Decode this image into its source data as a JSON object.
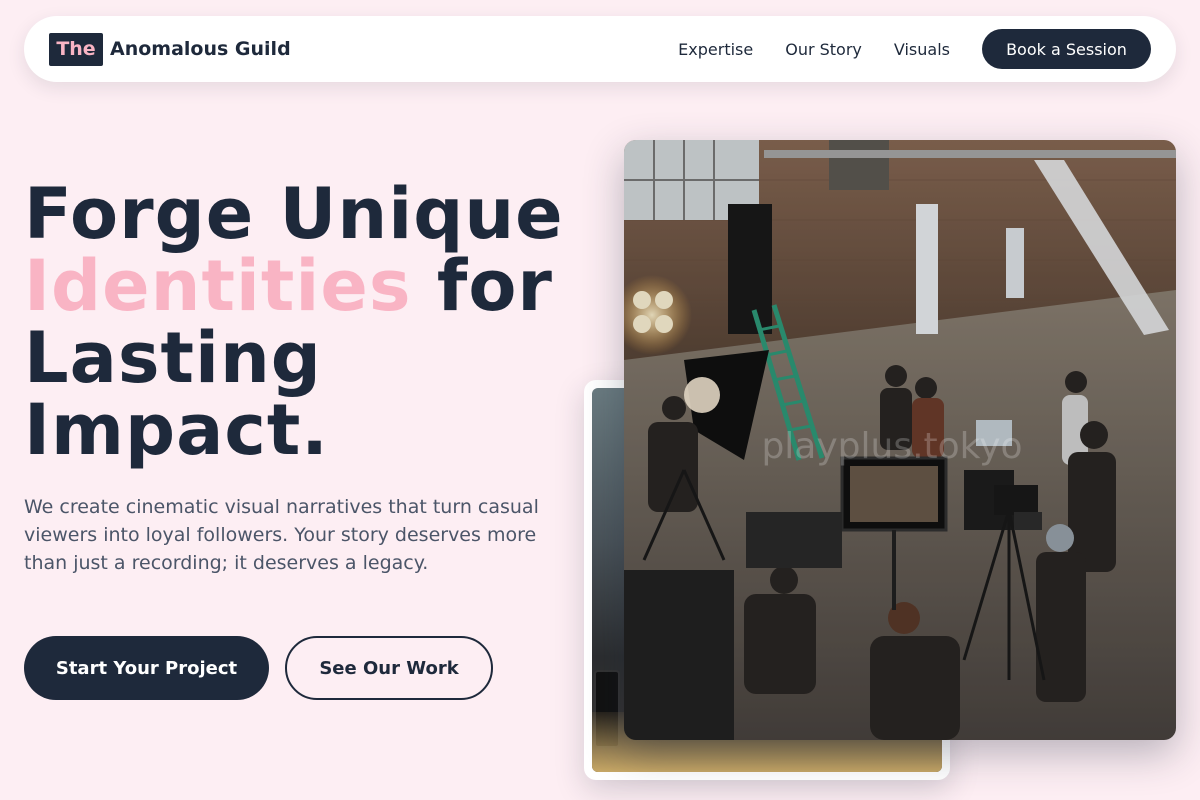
{
  "nav": {
    "logo_badge": "The",
    "logo_text": "Anomalous Guild",
    "links": [
      "Expertise",
      "Our Story",
      "Visuals"
    ],
    "cta": "Book a Session"
  },
  "hero": {
    "headline_line1": "Forge Unique",
    "headline_accent": "Identities",
    "headline_after_accent": " for",
    "headline_line3": "Lasting",
    "headline_line4": "Impact.",
    "lede": "We create cinematic visual narratives that turn casual viewers into loyal followers. Your story deserves more than just a recording; it deserves a legacy.",
    "primary_cta": "Start Your Project",
    "secondary_cta": "See Our Work"
  },
  "images": {
    "front_watermark": "playplus.tokyo"
  },
  "colors": {
    "background": "#fdeef3",
    "navy": "#1e293b",
    "accent_pink": "#f9b4c4",
    "muted_text": "#4b5568"
  }
}
